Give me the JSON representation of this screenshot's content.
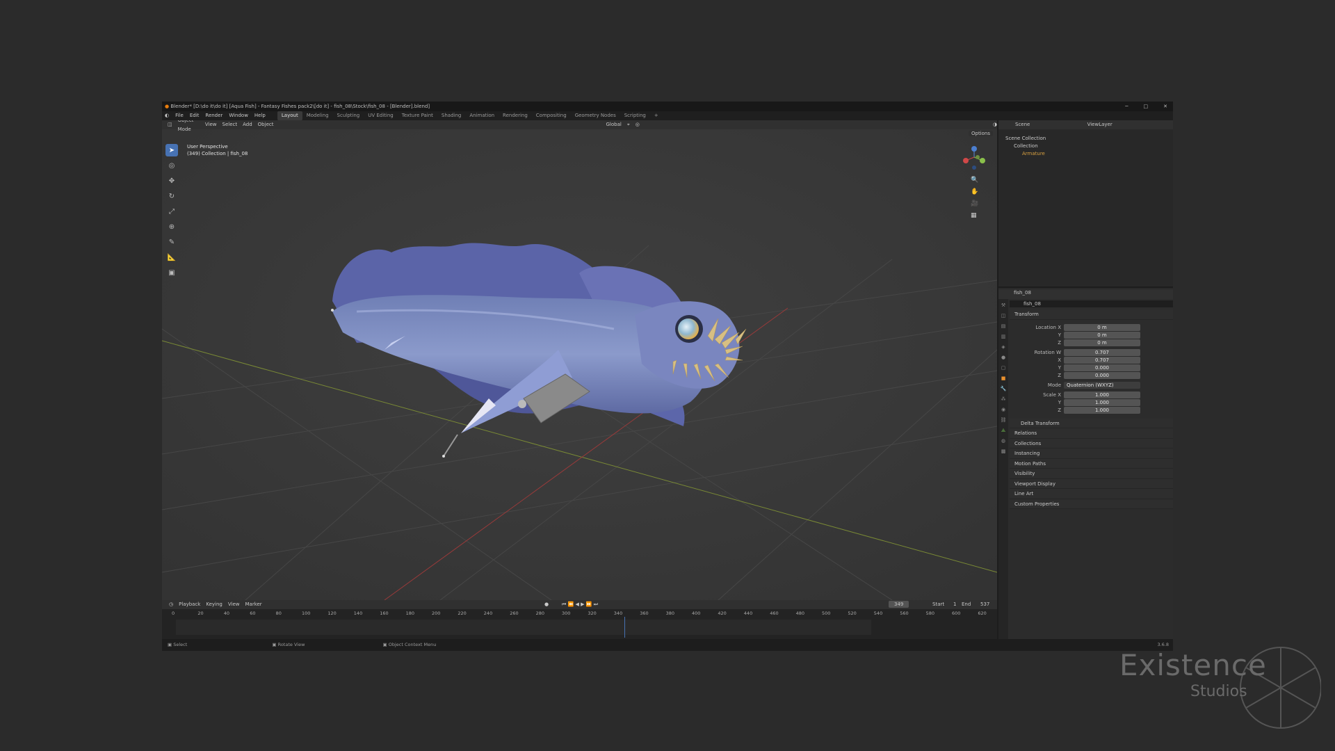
{
  "window": {
    "title": "Blender* [D:\\do it\\do it] [Aqua Fish] - Fantasy Fishes pack2\\[do it] - fish_08\\Stock\\fish_08 - [Blender].blend]"
  },
  "menubar": {
    "items": [
      "File",
      "Edit",
      "Render",
      "Window",
      "Help"
    ],
    "workspaces": [
      "Layout",
      "Modeling",
      "Sculpting",
      "UV Editing",
      "Texture Paint",
      "Shading",
      "Animation",
      "Rendering",
      "Compositing",
      "Geometry Nodes",
      "Scripting"
    ],
    "active": "Layout"
  },
  "viewport": {
    "mode": "Object Mode",
    "menus": [
      "View",
      "Select",
      "Add",
      "Object"
    ],
    "orientation": "Global",
    "options": "Options",
    "info": {
      "line1": "User Perspective",
      "line2": "(349) Collection | fish_08"
    }
  },
  "outliner": {
    "scene": "Scene",
    "viewlayer": "ViewLayer",
    "rows": [
      "Scene Collection",
      "Collection",
      "Armature"
    ]
  },
  "properties": {
    "object_name": "fish_08",
    "data_name": "fish_08",
    "transform_header": "Transform",
    "location": {
      "label": "Location X",
      "x": "0 m",
      "y": "0 m",
      "z": "0 m"
    },
    "rotation": {
      "label": "Rotation W",
      "w": "0.707",
      "x": "0.707",
      "y": "0.000",
      "z": "0.000"
    },
    "mode": {
      "label": "Mode",
      "value": "Quaternion (WXYZ)"
    },
    "scale": {
      "label": "Scale X",
      "x": "1.000",
      "y": "1.000",
      "z": "1.000"
    },
    "axis_labels": {
      "x": "X",
      "y": "Y",
      "z": "Z"
    },
    "sections": [
      "Delta Transform",
      "Relations",
      "Collections",
      "Instancing",
      "Motion Paths",
      "Visibility",
      "Viewport Display",
      "Line Art",
      "Custom Properties"
    ]
  },
  "timeline": {
    "menus": [
      "Playback",
      "Keying",
      "View",
      "Marker"
    ],
    "current_frame": "349",
    "start_label": "Start",
    "start": "1",
    "end_label": "End",
    "end": "537",
    "ticks": [
      "0",
      "20",
      "40",
      "60",
      "80",
      "100",
      "120",
      "140",
      "160",
      "180",
      "200",
      "220",
      "240",
      "260",
      "280",
      "300",
      "320",
      "340",
      "360",
      "380",
      "400",
      "420",
      "440",
      "460",
      "480",
      "500",
      "520",
      "540",
      "560",
      "580",
      "600",
      "620"
    ]
  },
  "statusbar": {
    "items": [
      "Select",
      "Rotate View",
      "Object Context Menu"
    ],
    "version": "3.6.8"
  },
  "watermark": {
    "line1": "Existence",
    "line2": "Studios"
  }
}
